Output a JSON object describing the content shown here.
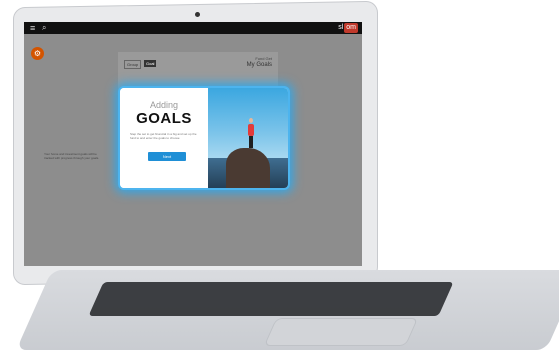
{
  "header": {
    "brand": "sl",
    "brand_suffix": "om"
  },
  "panel": {
    "links": "Fund  Get",
    "title": "My Goals",
    "tab_1": "Group",
    "tab_2": "Goal"
  },
  "modal": {
    "heading_light": "Adding",
    "heading_bold": "GOALS",
    "description": "Step the set to get financial in a big and set up the fund to and enter the goals to choose",
    "button_label": "Next"
  },
  "background_text": "Your home and investment goals will be tracked with progress through your goals."
}
